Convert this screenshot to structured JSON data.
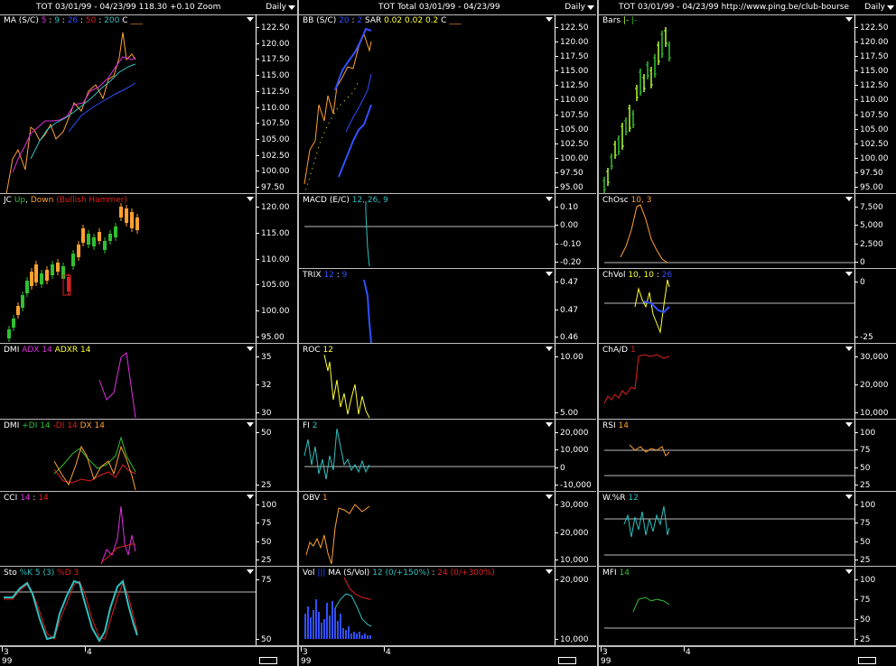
{
  "colors": {
    "white": "#ffffff",
    "orange": "#ffa030",
    "blue": "#3050ff",
    "cyan": "#30c0c0",
    "magenta": "#e030e0",
    "red": "#e02020",
    "yellow": "#ffff30",
    "green": "#30c030",
    "lime": "#b0ff30",
    "grid": "#bdbdbd"
  },
  "columns": [
    {
      "id": "c1",
      "header_title": "TOT  03/01/99 - 04/23/99    118.30   +0.10    Zoom",
      "timeframe": "Daily",
      "panels": [
        {
          "id": "ma",
          "label": [
            {
              "t": "MA (S/C) ",
              "c": "white"
            },
            {
              "t": "5",
              "c": "magenta"
            },
            {
              "t": " : ",
              "c": "white"
            },
            {
              "t": "9",
              "c": "cyan"
            },
            {
              "t": " : ",
              "c": "white"
            },
            {
              "t": "26",
              "c": "blue"
            },
            {
              "t": " : ",
              "c": "white"
            },
            {
              "t": "50",
              "c": "red"
            },
            {
              "t": " : ",
              "c": "white"
            },
            {
              "t": "200",
              "c": "cyan"
            },
            {
              "t": "   C ",
              "c": "white"
            },
            {
              "t": "___",
              "c": "orange"
            }
          ],
          "ticks": [
            "122.50",
            "120.00",
            "117.50",
            "115.00",
            "112.50",
            "110.00",
            "107.50",
            "105.00",
            "102.50",
            "100.00",
            "97.50"
          ]
        },
        {
          "id": "jc",
          "label": [
            {
              "t": "JC ",
              "c": "white"
            },
            {
              "t": "Up",
              "c": "green"
            },
            {
              "t": ", ",
              "c": "white"
            },
            {
              "t": "Down",
              "c": "orange"
            },
            {
              "t": "  (Bullish Hammer)",
              "c": "red"
            }
          ],
          "ticks": [
            "120.00",
            "115.00",
            "110.00",
            "105.00",
            "100.00",
            "95.00"
          ]
        },
        {
          "id": "dmi1",
          "label": [
            {
              "t": "DMI ",
              "c": "white"
            },
            {
              "t": "ADX 14",
              "c": "magenta"
            },
            {
              "t": "  ",
              "c": "white"
            },
            {
              "t": "ADXR 14",
              "c": "yellow"
            }
          ],
          "ticks": [
            "35",
            "32",
            "30"
          ]
        },
        {
          "id": "dmi2",
          "label": [
            {
              "t": "DMI ",
              "c": "white"
            },
            {
              "t": "+DI 14",
              "c": "green"
            },
            {
              "t": "  ",
              "c": "white"
            },
            {
              "t": "-DI 14",
              "c": "red"
            },
            {
              "t": "  ",
              "c": "white"
            },
            {
              "t": "DX 14",
              "c": "orange"
            }
          ],
          "ticks": [
            "50",
            "25"
          ]
        },
        {
          "id": "cci",
          "label": [
            {
              "t": "CCI ",
              "c": "white"
            },
            {
              "t": "14",
              "c": "magenta"
            },
            {
              "t": " : ",
              "c": "white"
            },
            {
              "t": "14",
              "c": "red"
            }
          ],
          "ticks": [
            "100",
            "75",
            "50",
            "25"
          ]
        },
        {
          "id": "sto",
          "label": [
            {
              "t": "Sto ",
              "c": "white"
            },
            {
              "t": "%K 5 (3)",
              "c": "cyan"
            },
            {
              "t": "  ",
              "c": "white"
            },
            {
              "t": "%D 3",
              "c": "red"
            }
          ],
          "ticks": [
            "75",
            "50"
          ]
        }
      ],
      "x_ticks": [
        "3",
        "4"
      ],
      "year": "99"
    },
    {
      "id": "c2",
      "header_title": "TOT   Total   03/01/99 - 04/23/99",
      "timeframe": "Daily",
      "panels": [
        {
          "id": "bb",
          "label": [
            {
              "t": "BB (S/C) ",
              "c": "white"
            },
            {
              "t": "20",
              "c": "blue"
            },
            {
              "t": " : ",
              "c": "white"
            },
            {
              "t": "2",
              "c": "blue"
            },
            {
              "t": "    SAR  ",
              "c": "white"
            },
            {
              "t": "0.02",
              "c": "yellow"
            },
            {
              "t": "  ",
              "c": "white"
            },
            {
              "t": "0.02",
              "c": "yellow"
            },
            {
              "t": "  ",
              "c": "white"
            },
            {
              "t": "0.2",
              "c": "yellow"
            },
            {
              "t": "     C ",
              "c": "white"
            },
            {
              "t": "___",
              "c": "orange"
            }
          ],
          "ticks": [
            "122.50",
            "120.00",
            "117.50",
            "115.00",
            "112.50",
            "110.00",
            "107.50",
            "105.00",
            "102.50",
            "100.00",
            "97.50",
            "95.00"
          ]
        },
        {
          "id": "macd",
          "label": [
            {
              "t": "MACD (E/C)  ",
              "c": "white"
            },
            {
              "t": "12, 26, 9",
              "c": "cyan"
            }
          ],
          "ticks": [
            "0.10",
            "0.00",
            "-0.10",
            "-0.20"
          ]
        },
        {
          "id": "trix",
          "label": [
            {
              "t": "TRIX  ",
              "c": "white"
            },
            {
              "t": "12",
              "c": "blue"
            },
            {
              "t": " : ",
              "c": "white"
            },
            {
              "t": "9",
              "c": "blue"
            }
          ],
          "ticks": [
            "0.47",
            "0.47",
            "0.46"
          ]
        },
        {
          "id": "roc",
          "label": [
            {
              "t": "ROC  ",
              "c": "white"
            },
            {
              "t": "12",
              "c": "yellow"
            }
          ],
          "ticks": [
            "10.00",
            "5.00"
          ]
        },
        {
          "id": "fi",
          "label": [
            {
              "t": "FI  ",
              "c": "white"
            },
            {
              "t": "2",
              "c": "cyan"
            }
          ],
          "ticks": [
            "20,000",
            "10,000",
            "0",
            "-10,000"
          ]
        },
        {
          "id": "obv",
          "label": [
            {
              "t": "OBV  ",
              "c": "white"
            },
            {
              "t": "1",
              "c": "orange"
            }
          ],
          "ticks": [
            "30,000",
            "20,000",
            "10,000"
          ]
        },
        {
          "id": "vol",
          "label": [
            {
              "t": "Vol  ",
              "c": "white"
            },
            {
              "t": "|||",
              "c": "blue"
            },
            {
              "t": "   MA  (S/Vol)  ",
              "c": "white"
            },
            {
              "t": "12 (0/+150%)",
              "c": "cyan"
            },
            {
              "t": " : ",
              "c": "white"
            },
            {
              "t": "24 (0/+300%)",
              "c": "red"
            }
          ],
          "ticks": [
            "20,000",
            "10,000"
          ]
        }
      ],
      "x_ticks": [
        "3",
        "4"
      ],
      "year": "99"
    },
    {
      "id": "c3",
      "header_title": "TOT  03/01/99 - 04/23/99       http://www.ping.be/club-bourse",
      "timeframe": "Daily",
      "panels": [
        {
          "id": "bars",
          "label": [
            {
              "t": "Bars ",
              "c": "white"
            },
            {
              "t": "|-",
              "c": "lime"
            },
            {
              "t": "  ",
              "c": "white"
            },
            {
              "t": "|-",
              "c": "green"
            }
          ],
          "ticks": [
            "122.50",
            "120.00",
            "117.50",
            "115.00",
            "112.50",
            "110.00",
            "107.50",
            "105.00",
            "102.50",
            "100.00",
            "97.50",
            "95.00"
          ]
        },
        {
          "id": "chosc",
          "label": [
            {
              "t": "ChOsc  ",
              "c": "white"
            },
            {
              "t": "10, 3",
              "c": "orange"
            }
          ],
          "ticks": [
            "7,500",
            "5,000",
            "2,500",
            "0"
          ]
        },
        {
          "id": "chvol",
          "label": [
            {
              "t": "ChVol  ",
              "c": "white"
            },
            {
              "t": "10, 10",
              "c": "yellow"
            },
            {
              "t": " : ",
              "c": "white"
            },
            {
              "t": "26",
              "c": "blue"
            }
          ],
          "ticks": [
            "0",
            "-25"
          ]
        },
        {
          "id": "chad",
          "label": [
            {
              "t": "ChA/D  ",
              "c": "white"
            },
            {
              "t": "1",
              "c": "red"
            }
          ],
          "ticks": [
            "30,000",
            "20,000",
            "10,000"
          ]
        },
        {
          "id": "rsi",
          "label": [
            {
              "t": "RSI  ",
              "c": "white"
            },
            {
              "t": "14",
              "c": "orange"
            }
          ],
          "ticks": [
            "100",
            "75",
            "50",
            "25"
          ]
        },
        {
          "id": "wr",
          "label": [
            {
              "t": "W.%R  ",
              "c": "white"
            },
            {
              "t": "12",
              "c": "cyan"
            }
          ],
          "ticks": [
            "100",
            "75",
            "50",
            "25"
          ]
        },
        {
          "id": "mfi",
          "label": [
            {
              "t": "MFI  ",
              "c": "white"
            },
            {
              "t": "14",
              "c": "green"
            }
          ],
          "ticks": [
            "100",
            "75",
            "50",
            "25"
          ]
        }
      ],
      "x_ticks": [
        "3",
        "4"
      ],
      "year": "99"
    }
  ],
  "chart_data": {
    "type": "line",
    "title": "TOT 03/01/99 - 04/23/99",
    "last": "118.30",
    "change": "+0.10",
    "price_range": [
      95.0,
      123.0
    ],
    "close_approx": [
      98,
      104,
      101,
      107,
      110,
      108,
      105,
      112,
      110,
      109,
      115,
      117,
      113,
      118,
      119,
      116,
      120,
      122.5,
      118,
      119,
      118.3
    ],
    "indicators": [
      "MA",
      "JC",
      "DMI",
      "CCI",
      "Sto",
      "BB",
      "SAR",
      "MACD",
      "TRIX",
      "ROC",
      "FI",
      "OBV",
      "Vol",
      "Bars",
      "ChOsc",
      "ChVol",
      "ChA/D",
      "RSI",
      "W.%R",
      "MFI"
    ]
  }
}
